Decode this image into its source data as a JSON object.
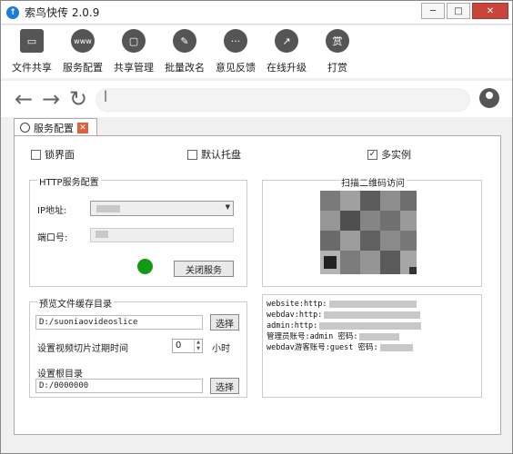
{
  "window": {
    "title": "索鸟快传 2.0.9",
    "app_icon_glyph": "↑",
    "controls": {
      "minimize": "─",
      "maximize": "□",
      "close": "✕"
    }
  },
  "toolbar": {
    "items": [
      {
        "label": "文件共享",
        "icon": "monitor-icon",
        "glyph": "▭"
      },
      {
        "label": "服务配置",
        "icon": "www-icon",
        "glyph": "www"
      },
      {
        "label": "共享管理",
        "icon": "folder-icon",
        "glyph": "▢"
      },
      {
        "label": "批量改名",
        "icon": "pencil-icon",
        "glyph": "✎"
      },
      {
        "label": "意见反馈",
        "icon": "chat-icon",
        "glyph": "···"
      },
      {
        "label": "在线升级",
        "icon": "trend-icon",
        "glyph": "↗"
      },
      {
        "label": "打赏",
        "icon": "reward-icon",
        "glyph": "赏"
      }
    ]
  },
  "nav": {
    "back_glyph": "←",
    "forward_glyph": "→",
    "refresh_glyph": "↻",
    "url_value": "|"
  },
  "tab": {
    "label": "服务配置",
    "close_glyph": "✕"
  },
  "options": {
    "lock_ui": {
      "label": "锁界面",
      "checked": false
    },
    "default_tray": {
      "label": "默认托盘",
      "checked": false
    },
    "multi_instance": {
      "label": "多实例",
      "checked": true,
      "check_glyph": "✓"
    }
  },
  "http": {
    "group_title": "HTTP服务配置",
    "ip_label": "IP地址:",
    "port_label": "端口号:",
    "status_color": "#129a14",
    "stop_button": "关闭服务"
  },
  "cache": {
    "group_title": "预览文件缓存目录",
    "path_value": "D:/suoniaovideoslice",
    "choose_button": "选择",
    "expire_label": "设置视频切片过期时间",
    "expire_value": "0",
    "expire_unit": "小时",
    "root_label": "设置根目录",
    "root_value": "D:/0000000",
    "root_button": "选择"
  },
  "qr": {
    "title": "扫描二维码访问"
  },
  "info": {
    "lines": [
      {
        "prefix": "website:http:"
      },
      {
        "prefix": "webdav:http:"
      },
      {
        "prefix": "admin:http:"
      },
      {
        "prefix": "管理员账号:admin 密码:"
      },
      {
        "prefix": "webdav游客账号:guest 密码:"
      }
    ]
  }
}
